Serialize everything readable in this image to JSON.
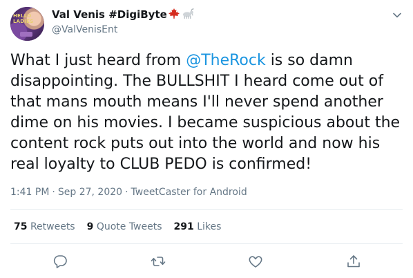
{
  "user": {
    "display_name": "Val Venis #DigiByte",
    "emojis": [
      "maple-leaf-icon",
      "goat-icon"
    ],
    "handle": "@ValVenisEnt",
    "avatar_text": "HELLO LADIES"
  },
  "tweet": {
    "text_before": "What I just heard from ",
    "mention": "@TheRock",
    "text_after": " is so damn disappointing. The BULLSHIT I heard come out of that mans mouth means I'll never spend another dime on his movies. I became suspicious about the content rock puts out into the world and now his real loyalty to CLUB PEDO is confirmed!"
  },
  "meta": {
    "time": "1:41 PM",
    "date": "Sep 27, 2020",
    "source": "TweetCaster for Android",
    "separator": "·"
  },
  "stats": {
    "retweets_count": "75",
    "retweets_label": "Retweets",
    "quotes_count": "9",
    "quotes_label": "Quote Tweets",
    "likes_count": "291",
    "likes_label": "Likes"
  },
  "actions": [
    "reply-icon",
    "retweet-icon",
    "like-icon",
    "share-icon"
  ],
  "colors": {
    "text": "#14171a",
    "secondary": "#657786",
    "link": "#1b95e0",
    "divider": "#e6ecf0",
    "maple_leaf": "#d52b1e"
  }
}
